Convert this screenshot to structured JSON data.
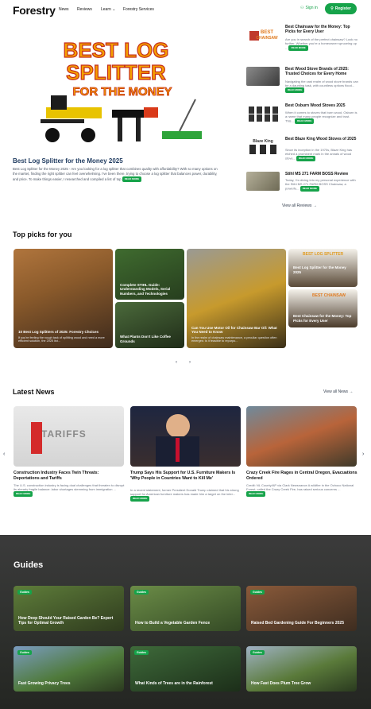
{
  "header": {
    "logo": "Forestry",
    "logo_sub": "",
    "nav": [
      "News",
      "Reviews",
      "Learn",
      "Forestry Services"
    ],
    "signin": "Sign in",
    "register": "Register"
  },
  "hero": {
    "banner_line1": "BEST LOG",
    "banner_line2": "SPLITTER",
    "banner_line3": "FOR THE MONEY",
    "title": "Best Log Splitter for the Money 2025",
    "desc": "Best Log Splitter for the Money 2025 - Are you looking for a log splitter that combines quality with affordability? With so many options on the market, finding the right splitter can feel overwhelming. I've been there, trying to choose a log splitter that balances power, durability, and price. To make things easier, I researched and compiled a list of top",
    "read_more": "READ MORE"
  },
  "reviews": [
    {
      "title": "Best Chainsaw for the Money: Top Picks for Every User",
      "desc": "Are you in search of the perfect chainsaw? Look no further. Whether you're a homeowner spruceing up ...",
      "read": "READ MORE"
    },
    {
      "title": "Best Wood Stove Brands of 2025: Trusted Choices for Every Home",
      "desc": "Navigating the vast realm of wood stove brands can be a daunting task, with countless options flood...",
      "read": "READ MORE"
    },
    {
      "title": "Best Osburn Wood Stoves 2025",
      "desc": "When it comes to stoves that burn wood, Osburn is a name that many people recognize and trust. This...",
      "read": "READ MORE"
    },
    {
      "title": "Best Blaze King Wood Stoves of 2025",
      "desc": "Since its inception in the 1970s, Blaze King has etched a prominent mark in the annals of wood stove...",
      "read": "READ MORE"
    },
    {
      "title": "Stihl MS 271 FARM BOSS Review",
      "desc": "Today, I'm diving into my personal experience with the Stihl MS 271 FARM BOSS Chainsaw, a powerfu...",
      "read": "READ MORE"
    }
  ],
  "view_all_reviews": "View all Reviews",
  "top_picks": {
    "heading": "Top picks for you",
    "cards": [
      {
        "title": "10 Best Log Splitters of 2025: Forestry Choices",
        "desc": "If you're feeling the rough task of splitting wood and need a more efficient solution, the 2025 list..."
      },
      {
        "title": "Complete STIHL Guide: Understanding Models, Serial Numbers, and Technologies",
        "desc": ""
      },
      {
        "title": "What Plants Don't Like Coffee Grounds",
        "desc": ""
      },
      {
        "title": "Can You Use Motor Oil for Chainsaw Bar Oil: What You Need to Know",
        "desc": "In the realm of chainsaw maintenance, a peculiar question often emerges: Is it feasible to repurpo..."
      },
      {
        "title": "Best Log Splitter for the Money 2025",
        "desc": "",
        "banner": "BEST LOG SPLITTER"
      },
      {
        "title": "Best Chainsaw for the Money: Top Picks for Every User",
        "desc": "",
        "banner": "BEST CHAINSAW"
      }
    ]
  },
  "latest_news": {
    "heading": "Latest News",
    "view_all": "View all News",
    "items": [
      {
        "title": "Construction Industry Faces Twin Threats: Deportations and Tariffs",
        "desc": "The U.S. construction industry is facing dual challenges that threaten to disrupt its already fragile balance: labor shortages stemming from immigration ...",
        "img_text": "TARIFFS"
      },
      {
        "title": "Trump Says His Support for U.S. Furniture Makers Is 'Why People in Countries Want to Kill Me'",
        "desc": "In a recent statement, former President Donald Trump claimed that his strong support for American furniture makers has made him a target on the inter...",
        "img_text": ""
      },
      {
        "title": "Crazy Creek Fire Rages in Central Oregon, Evacuations Ordered",
        "desc": "Credit: NL County/AP via Clark Newsnance A wildfire in the Ochoco National Forest, called the Crazy Creek Fire, has raised serious concerns ...",
        "img_text": ""
      }
    ],
    "read": "READ MORE"
  },
  "guides": {
    "heading": "Guides",
    "tag": "Guides",
    "items": [
      {
        "title": "How Deep Should Your Raised Garden Be? Expert Tips for Optimal Growth"
      },
      {
        "title": "How to Build a Vegetable Garden Fence"
      },
      {
        "title": "Raised Bed Gardening Guide For Beginners 2025"
      },
      {
        "title": "Fast Growing Privacy Trees"
      },
      {
        "title": "What Kinds of Trees are in the Rainforest"
      },
      {
        "title": "How Fast Does Plum Tree Grow"
      }
    ]
  }
}
